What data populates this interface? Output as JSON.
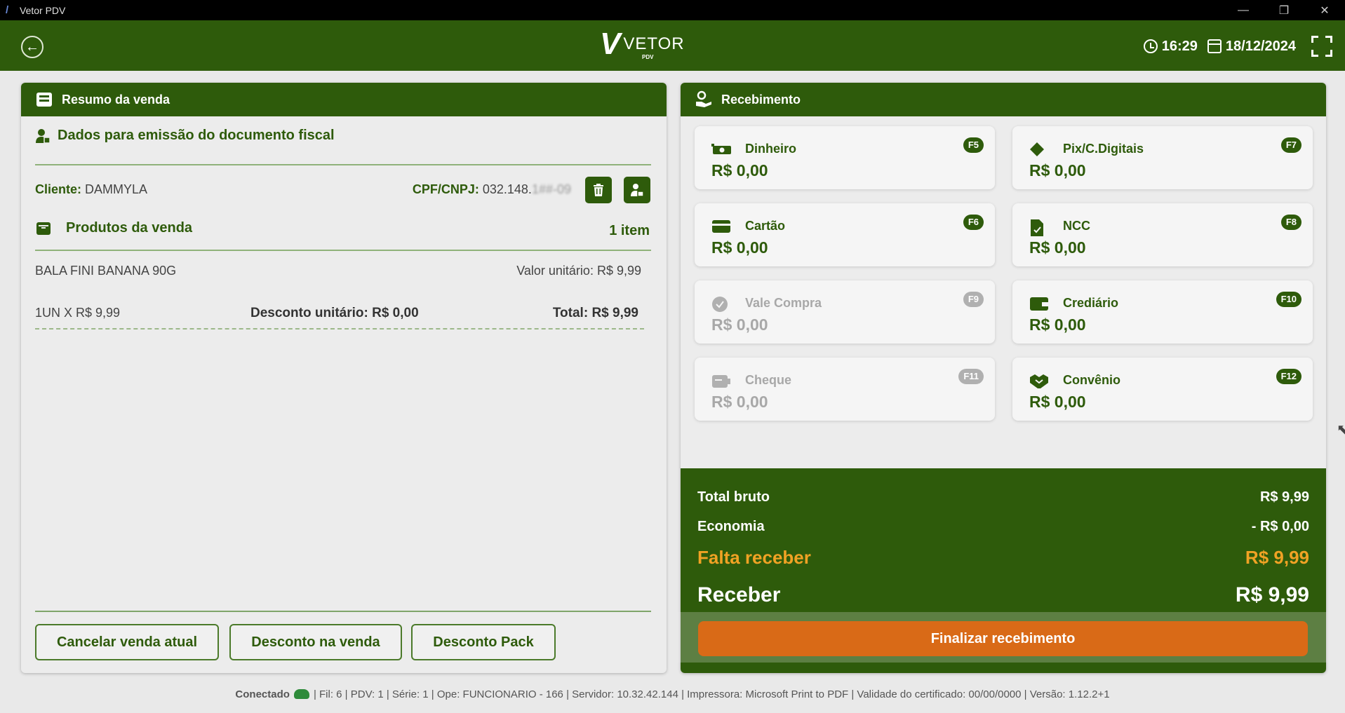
{
  "window": {
    "title": "Vetor PDV",
    "min": "—",
    "max": "❐",
    "close": "✕"
  },
  "header": {
    "back_icon": "←",
    "brand_mark": "V",
    "brand_word": "VETOR",
    "brand_sub": "PDV",
    "time": "16:29",
    "date": "18/12/2024"
  },
  "left": {
    "title": "Resumo da venda",
    "fiscal_title": "Dados para emissão do documento fiscal",
    "cliente_label": "Cliente:",
    "cliente_value": "DAMMYLA",
    "cpf_label": "CPF/CNPJ:",
    "cpf_value": "032.148.",
    "cpf_hidden": "1##-09",
    "products_title": "Produtos da venda",
    "item_count": "1 item",
    "product": {
      "name": "BALA FINI BANANA 90G",
      "unit_value": "Valor unitário: R$ 9,99",
      "qty": "1UN X R$ 9,99",
      "discount": "Desconto unitário: R$ 0,00",
      "total": "Total: R$ 9,99"
    },
    "buttons": {
      "cancel": "Cancelar venda atual",
      "discount_sale": "Desconto na venda",
      "discount_pack": "Desconto Pack"
    }
  },
  "right": {
    "title": "Recebimento",
    "payments": [
      {
        "name": "Dinheiro",
        "value": "R$  0,00",
        "key": "F5",
        "icon": "cash-icon",
        "enabled": true
      },
      {
        "name": "Pix/C.Digitais",
        "value": "R$  0,00",
        "key": "F7",
        "icon": "pix-icon",
        "enabled": true
      },
      {
        "name": "Cartão",
        "value": "R$  0,00",
        "key": "F6",
        "icon": "card-icon",
        "enabled": true
      },
      {
        "name": "NCC",
        "value": "R$  0,00",
        "key": "F8",
        "icon": "document-icon",
        "enabled": true
      },
      {
        "name": "Vale Compra",
        "value": "R$  0,00",
        "key": "F9",
        "icon": "voucher-icon",
        "enabled": false
      },
      {
        "name": "Crediário",
        "value": "R$  0,00",
        "key": "F10",
        "icon": "wallet-icon",
        "enabled": true
      },
      {
        "name": "Cheque",
        "value": "R$  0,00",
        "key": "F11",
        "icon": "cheque-icon",
        "enabled": false
      },
      {
        "name": "Convênio",
        "value": "R$  0,00",
        "key": "F12",
        "icon": "handshake-icon",
        "enabled": true
      }
    ],
    "summary": {
      "total_bruto_label": "Total bruto",
      "total_bruto_value": "R$ 9,99",
      "economia_label": "Economia",
      "economia_value": "- R$ 0,00",
      "falta_label": "Falta receber",
      "falta_value": "R$ 9,99",
      "receber_label": "Receber",
      "receber_value": "R$ 9,99"
    },
    "finalize": "Finalizar recebimento"
  },
  "status": {
    "connected": "Conectado",
    "info": "| Fil: 6 | PDV: 1 | Série: 1 | Ope: FUNCIONARIO - 166 | Servidor: 10.32.42.144 | Impressora: Microsoft Print to PDF | Validade do certificado: 00/00/0000 | Versão: 1.12.2+1"
  },
  "colors": {
    "primary": "#2e5b0b",
    "accent": "#d96a17",
    "warning": "#f0a224"
  }
}
